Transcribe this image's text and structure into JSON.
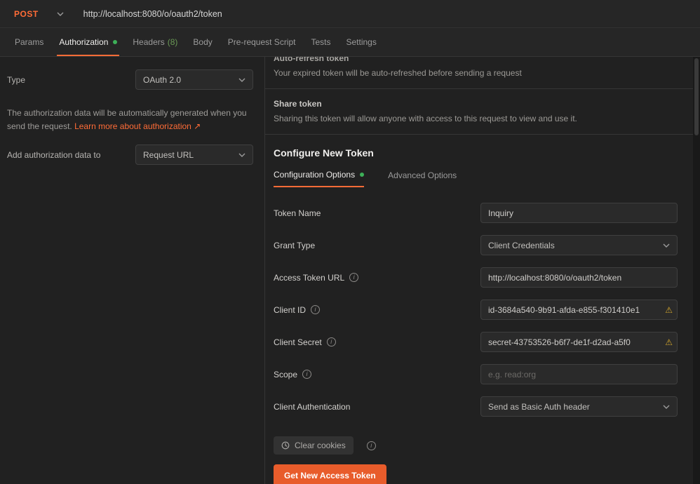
{
  "colors": {
    "accent": "#ff6c37",
    "button": "#e85c2b",
    "green": "#3db058",
    "warning": "#d4a72c",
    "count": "#6a9955"
  },
  "request_bar": {
    "method": "POST",
    "url": "http://localhost:8080/o/oauth2/token"
  },
  "tabs": {
    "params": "Params",
    "authorization": "Authorization",
    "headers": "Headers",
    "headers_count": "(8)",
    "body": "Body",
    "pre_request": "Pre-request Script",
    "tests": "Tests",
    "settings": "Settings"
  },
  "left_panel": {
    "type_label": "Type",
    "type_value": "OAuth 2.0",
    "description": "The authorization data will be automatically generated when you send the request.",
    "learn_more": "Learn more about authorization ↗",
    "add_to_label": "Add authorization data to",
    "add_to_value": "Request URL"
  },
  "right_panel": {
    "auto_refresh_title": "Auto-refresh token",
    "auto_refresh_description": "Your expired token will be auto-refreshed before sending a request",
    "share_title": "Share token",
    "share_description": "Sharing this token will allow anyone with access to this request to view and use it.",
    "configure_title": "Configure New Token",
    "tab_configuration": "Configuration Options",
    "tab_advanced": "Advanced Options",
    "form": {
      "token_name": {
        "label": "Token Name",
        "value": "Inquiry"
      },
      "grant_type": {
        "label": "Grant Type",
        "value": "Client Credentials"
      },
      "access_token_url": {
        "label": "Access Token URL",
        "value": "http://localhost:8080/o/oauth2/token"
      },
      "client_id": {
        "label": "Client ID",
        "value": "id-3684a540-9b91-afda-e855-f301410e1"
      },
      "client_secret": {
        "label": "Client Secret",
        "value": "secret-43753526-b6f7-de1f-d2ad-a5f0"
      },
      "scope": {
        "label": "Scope",
        "placeholder": "e.g. read:org"
      },
      "client_authentication": {
        "label": "Client Authentication",
        "value": "Send as Basic Auth header"
      }
    },
    "clear_cookies_label": "Clear cookies",
    "get_token_label": "Get New Access Token"
  },
  "icons": {
    "info": "i",
    "warning": "⚠"
  }
}
